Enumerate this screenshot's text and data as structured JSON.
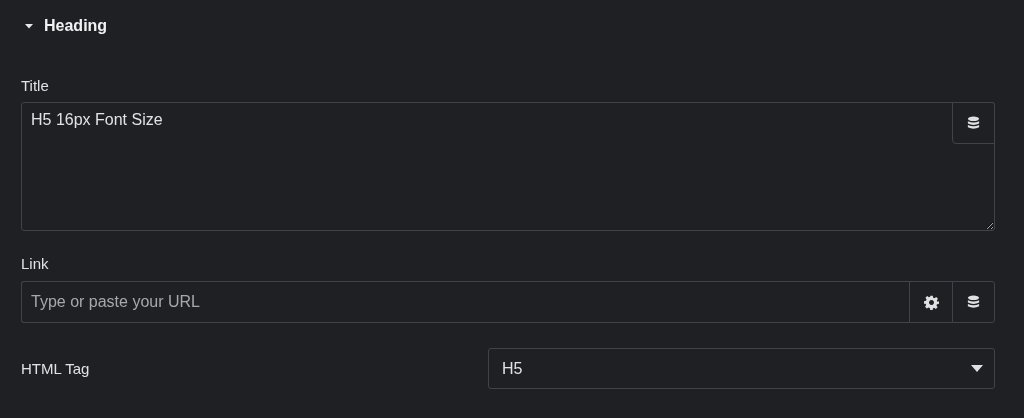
{
  "section": {
    "title": "Heading",
    "expanded": true
  },
  "title_field": {
    "label": "Title",
    "value": "H5 16px Font Size"
  },
  "link_field": {
    "label": "Link",
    "placeholder": "Type or paste your URL"
  },
  "html_tag": {
    "label": "HTML Tag",
    "value": "H5"
  }
}
